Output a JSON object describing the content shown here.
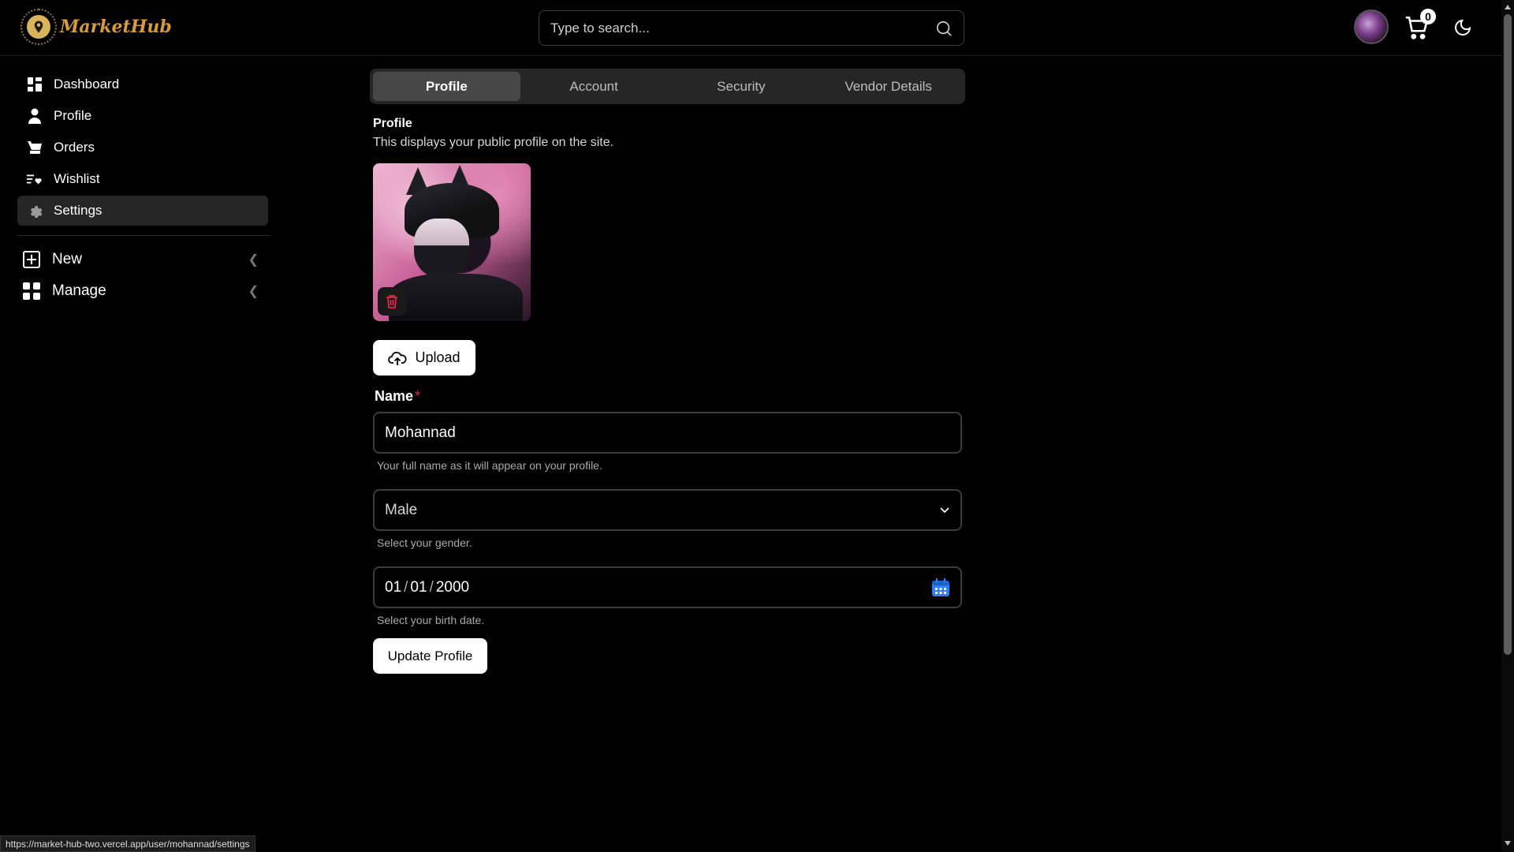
{
  "brand": {
    "name": "MarketHub"
  },
  "search": {
    "placeholder": "Type to search..."
  },
  "header": {
    "cart_count": "0"
  },
  "sidebar": {
    "items": [
      {
        "label": "Dashboard",
        "icon": "dashboard-icon"
      },
      {
        "label": "Profile",
        "icon": "user-icon"
      },
      {
        "label": "Orders",
        "icon": "orders-icon"
      },
      {
        "label": "Wishlist",
        "icon": "wishlist-icon"
      },
      {
        "label": "Settings",
        "icon": "gear-icon",
        "active": true
      }
    ],
    "groups": [
      {
        "label": "New",
        "icon": "plus-square-icon"
      },
      {
        "label": "Manage",
        "icon": "grid-icon"
      }
    ]
  },
  "tabs": [
    {
      "label": "Profile",
      "active": true
    },
    {
      "label": "Account"
    },
    {
      "label": "Security"
    },
    {
      "label": "Vendor Details"
    }
  ],
  "profile": {
    "title": "Profile",
    "description": "This displays your public profile on the site.",
    "upload_label": "Upload",
    "name_label": "Name",
    "required_mark": "*",
    "name_value": "Mohannad",
    "name_hint": "Your full name as it will appear on your profile.",
    "gender_value": "Male",
    "gender_hint": "Select your gender.",
    "birth_month": "01",
    "birth_day": "01",
    "birth_year": "2000",
    "birth_hint": "Select your birth date.",
    "submit_label": "Update Profile"
  },
  "status_bar": {
    "url": "https://market-hub-two.vercel.app/user/mohannad/settings"
  },
  "colors": {
    "accent_logo": "#d79a3c",
    "required": "#e0284a",
    "calendar": "#2f7ff0"
  }
}
